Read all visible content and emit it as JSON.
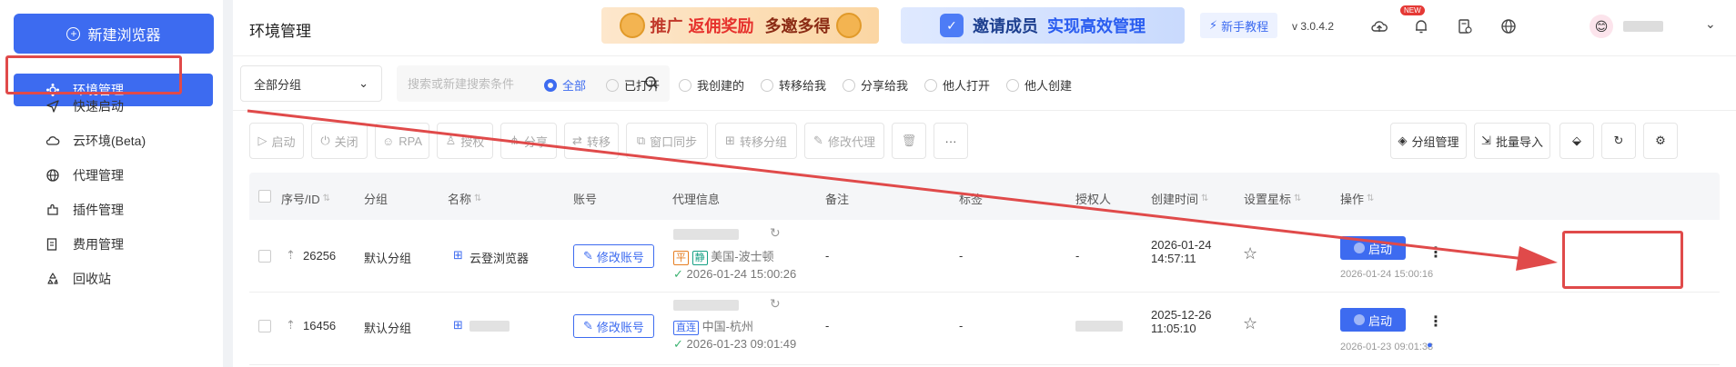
{
  "sidebar": {
    "new_browser": "新建浏览器",
    "items": [
      {
        "label": "环境管理",
        "icon": "dashboard-icon"
      },
      {
        "label": "快速启动",
        "icon": "send-icon"
      },
      {
        "label": "云环境(Beta)",
        "icon": "cloud-icon"
      },
      {
        "label": "代理管理",
        "icon": "globe-icon"
      },
      {
        "label": "插件管理",
        "icon": "plugin-icon"
      },
      {
        "label": "费用管理",
        "icon": "billing-icon"
      },
      {
        "label": "回收站",
        "icon": "recycle-icon"
      }
    ]
  },
  "header": {
    "title": "环境管理",
    "banner_promo": {
      "part1": "推广",
      "part2": "返佣奖励",
      "part3": "多邀多得"
    },
    "banner_invite": {
      "part1": "邀请成员",
      "part2": "实现高效管理"
    },
    "tutorial": "新手教程",
    "version": "v 3.0.4.2",
    "new_badge": "NEW"
  },
  "filters": {
    "group_select": "全部分组",
    "search_placeholder": "搜索或新建搜索条件",
    "radios": [
      "全部",
      "已打开",
      "我创建的",
      "转移给我",
      "分享给我",
      "他人打开",
      "他人创建"
    ],
    "selected": "全部"
  },
  "toolbar": {
    "start": "启动",
    "close": "关闭",
    "rpa": "RPA",
    "authorize": "授权",
    "share": "分享",
    "transfer": "转移",
    "window_sync": "窗口同步",
    "move_group": "转移分组",
    "edit_proxy": "修改代理",
    "group_manage": "分组管理",
    "batch_import": "批量导入"
  },
  "table": {
    "headers": {
      "id": "序号/ID",
      "group": "分组",
      "name": "名称",
      "account": "账号",
      "proxy": "代理信息",
      "note": "备注",
      "tags": "标签",
      "authorized": "授权人",
      "created": "创建时间",
      "star": "设置星标",
      "actions": "操作"
    },
    "rows": [
      {
        "id": "26256",
        "group": "默认分组",
        "name": "云登浏览器",
        "account_btn": "修改账号",
        "proxy_tag1": "平",
        "proxy_tag2": "静",
        "proxy_location": "美国-波士顿",
        "proxy_checked": "2026-01-24 15:00:26",
        "note": "-",
        "tags": "-",
        "authorized": "-",
        "created_date": "2026-01-24",
        "created_time": "14:57:11",
        "launch": "启动",
        "last_launch": "2026-01-24 15:00:16"
      },
      {
        "id": "16456",
        "group": "默认分组",
        "account_btn": "修改账号",
        "proxy_tag1": "直连",
        "proxy_location": "中国-杭州",
        "proxy_checked": "2026-01-23 09:01:49",
        "note": "-",
        "tags": "-",
        "created_date": "2025-12-26",
        "created_time": "11:05:10",
        "launch": "启动",
        "last_launch": "2026-01-23 09:01:38"
      }
    ]
  },
  "colors": {
    "accent": "#3d6bf0",
    "highlight": "#e04a4a",
    "check": "#3cb371"
  }
}
